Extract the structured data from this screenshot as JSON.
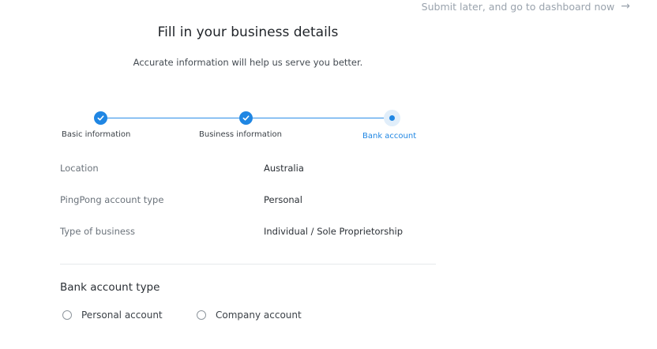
{
  "header": {
    "skip_link": "Submit later, and go to dashboard now",
    "skip_arrow_icon": "arrow-right-icon"
  },
  "form": {
    "title": "Fill in your business details",
    "subtitle": "Accurate information will help us serve you better."
  },
  "stepper": {
    "steps": [
      {
        "label": "Basic information",
        "status": "completed",
        "icon": "check-icon"
      },
      {
        "label": "Business information",
        "status": "completed",
        "icon": "check-icon"
      },
      {
        "label": "Bank account",
        "status": "current"
      }
    ],
    "accent_color": "#1f86e3"
  },
  "summary": {
    "rows": [
      {
        "label": "Location",
        "value": "Australia"
      },
      {
        "label": "PingPong account type",
        "value": "Personal"
      },
      {
        "label": "Type of business",
        "value": "Individual / Sole Proprietorship"
      }
    ]
  },
  "bank_account_type": {
    "title": "Bank account type",
    "options": [
      {
        "label": "Personal account",
        "selected": false
      },
      {
        "label": "Company account",
        "selected": false
      }
    ]
  }
}
